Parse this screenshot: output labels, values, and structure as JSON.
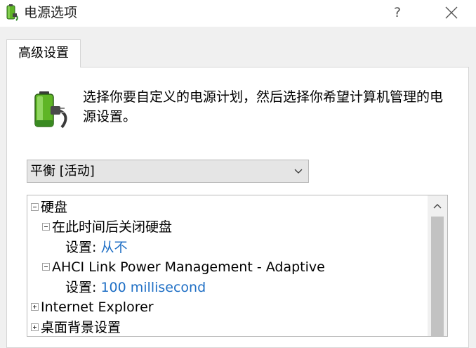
{
  "window": {
    "title": "电源选项",
    "help_label": "?"
  },
  "tabs": [
    {
      "label": "高级设置",
      "selected": true
    }
  ],
  "description": "选择你要自定义的电源计划，然后选择你希望计算机管理的电源设置。",
  "plan_select": {
    "value": "平衡 [活动]"
  },
  "tree": {
    "items": [
      {
        "label": "硬盘",
        "expander": "minus"
      },
      {
        "label": "在此时间后关闭硬盘",
        "expander": "minus"
      },
      {
        "label": "设置:",
        "value": "从不"
      },
      {
        "label": "AHCI Link Power Management - Adaptive",
        "expander": "minus"
      },
      {
        "label": "设置:",
        "value": "100 millisecond"
      },
      {
        "label": "Internet Explorer",
        "expander": "plus"
      },
      {
        "label": "桌面背景设置",
        "expander": "plus"
      }
    ]
  },
  "colors": {
    "value_link": "#1f6fc5",
    "battery_green": "#5fb526",
    "plug_green": "#2f8a2a"
  }
}
